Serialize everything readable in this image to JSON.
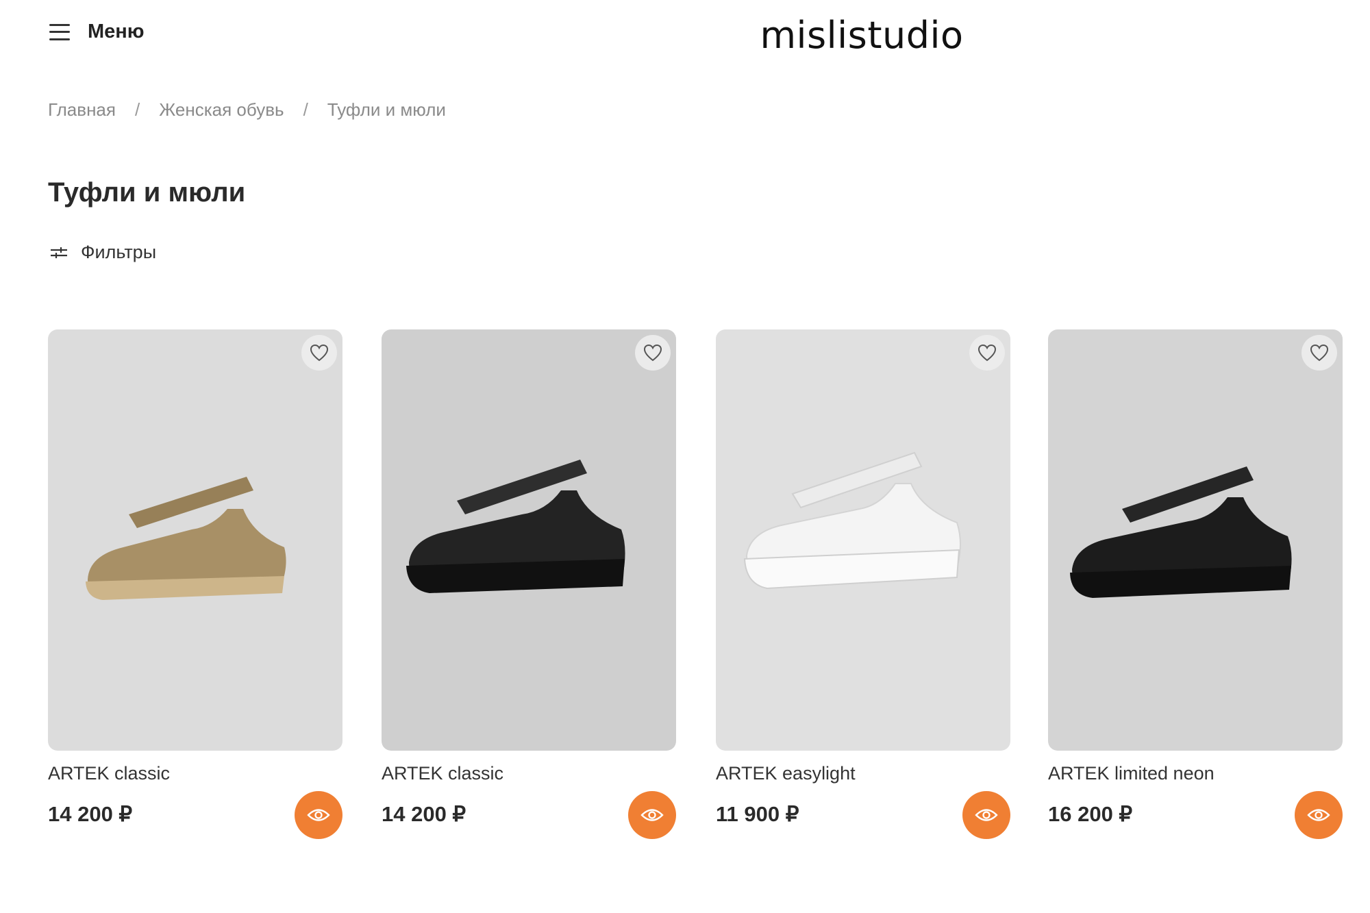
{
  "header": {
    "menu_label": "Меню",
    "logo": "mislistudio"
  },
  "breadcrumb": {
    "items": [
      "Главная",
      "Женская обувь",
      "Туфли и мюли"
    ],
    "separator": "/"
  },
  "page_title": "Туфли и мюли",
  "filters_label": "Фильтры",
  "colors": {
    "accent": "#f07f33",
    "favorite_bg": "#ececec",
    "photo_bg": "#d9d9d9"
  },
  "icons": {
    "menu": "hamburger-icon",
    "filters": "sliders-icon",
    "favorite": "heart-icon",
    "quick_view": "eye-icon"
  },
  "products": [
    {
      "name": "ARTEK classic",
      "price": "14 200 ₽",
      "shoe_color": "#a89066"
    },
    {
      "name": "ARTEK classic",
      "price": "14 200 ₽",
      "shoe_color": "#232323"
    },
    {
      "name": "ARTEK easylight",
      "price": "11 900 ₽",
      "shoe_color": "#f4f4f4"
    },
    {
      "name": "ARTEK limited neon",
      "price": "16 200 ₽",
      "shoe_color": "#1c1c1c"
    }
  ]
}
